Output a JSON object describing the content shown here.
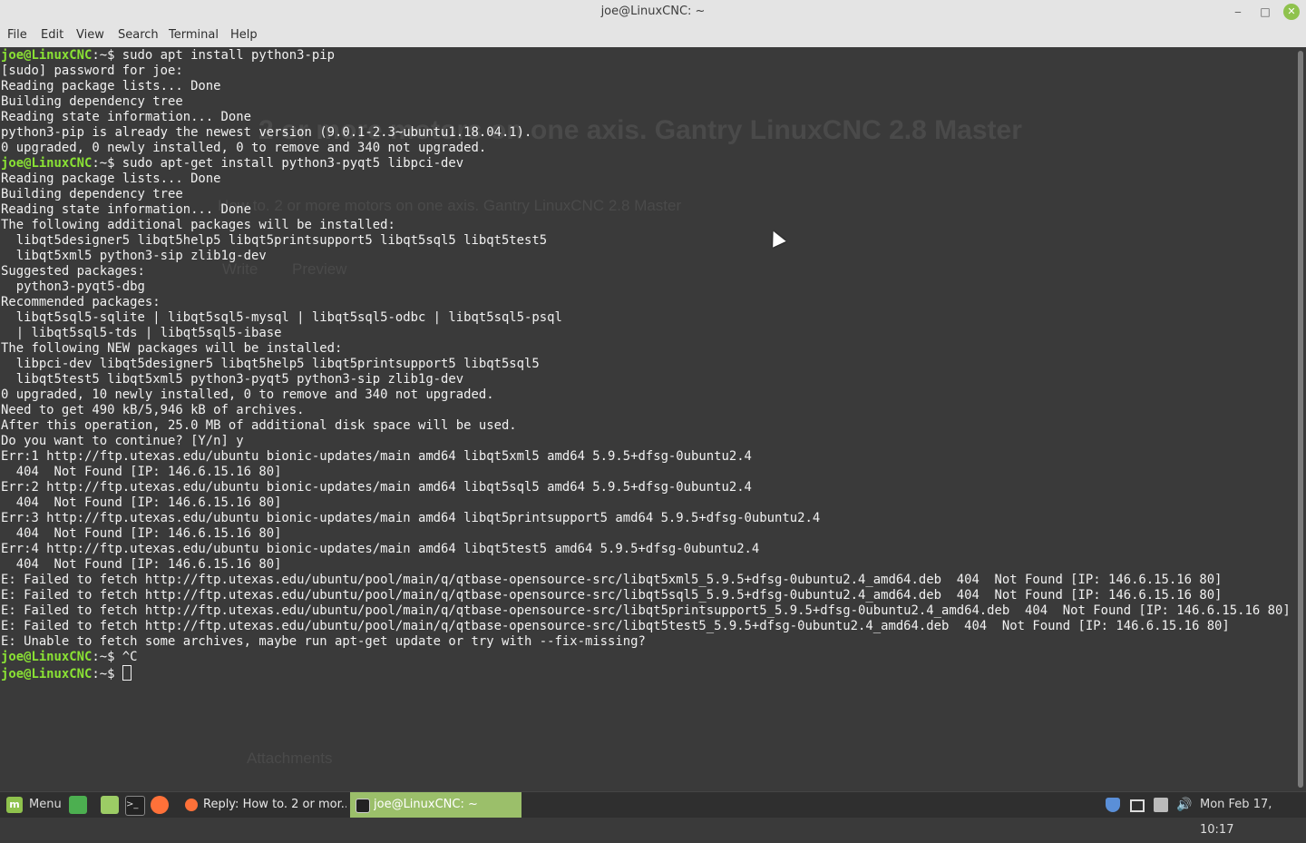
{
  "window": {
    "title": "joe@LinuxCNC: ~",
    "minimize_glyph": "‒",
    "maximize_glyph": "□",
    "close_glyph": "✕"
  },
  "menubar": [
    "File",
    "Edit",
    "View",
    "Search",
    "Terminal",
    "Help"
  ],
  "background_ghost": {
    "heading": "2 or more motors on one axis. Gantry LinuxCNC 2.8 Master",
    "subject": "How to. 2 or more motors on one axis. Gantry LinuxCNC 2.8 Master",
    "tab_write": "Write",
    "tab_preview": "Preview",
    "attachments": "Attachments"
  },
  "terminal": {
    "prompt": "joe@LinuxCNC",
    "lines": [
      {
        "prompt": true,
        "text": ":~$ sudo apt install python3-pip"
      },
      {
        "text": "[sudo] password for joe:"
      },
      {
        "text": "Reading package lists... Done"
      },
      {
        "text": "Building dependency tree"
      },
      {
        "text": "Reading state information... Done"
      },
      {
        "text": "python3-pip is already the newest version (9.0.1-2.3~ubuntu1.18.04.1)."
      },
      {
        "text": "0 upgraded, 0 newly installed, 0 to remove and 340 not upgraded."
      },
      {
        "prompt": true,
        "text": ":~$ sudo apt-get install python3-pyqt5 libpci-dev"
      },
      {
        "text": "Reading package lists... Done"
      },
      {
        "text": "Building dependency tree"
      },
      {
        "text": "Reading state information... Done"
      },
      {
        "text": "The following additional packages will be installed:"
      },
      {
        "text": "  libqt5designer5 libqt5help5 libqt5printsupport5 libqt5sql5 libqt5test5"
      },
      {
        "text": "  libqt5xml5 python3-sip zlib1g-dev"
      },
      {
        "text": "Suggested packages:"
      },
      {
        "text": "  python3-pyqt5-dbg"
      },
      {
        "text": "Recommended packages:"
      },
      {
        "text": "  libqt5sql5-sqlite | libqt5sql5-mysql | libqt5sql5-odbc | libqt5sql5-psql"
      },
      {
        "text": "  | libqt5sql5-tds | libqt5sql5-ibase"
      },
      {
        "text": "The following NEW packages will be installed:"
      },
      {
        "text": "  libpci-dev libqt5designer5 libqt5help5 libqt5printsupport5 libqt5sql5"
      },
      {
        "text": "  libqt5test5 libqt5xml5 python3-pyqt5 python3-sip zlib1g-dev"
      },
      {
        "text": "0 upgraded, 10 newly installed, 0 to remove and 340 not upgraded."
      },
      {
        "text": "Need to get 490 kB/5,946 kB of archives."
      },
      {
        "text": "After this operation, 25.0 MB of additional disk space will be used."
      },
      {
        "text": "Do you want to continue? [Y/n] y"
      },
      {
        "text": "Err:1 http://ftp.utexas.edu/ubuntu bionic-updates/main amd64 libqt5xml5 amd64 5.9.5+dfsg-0ubuntu2.4"
      },
      {
        "text": "  404  Not Found [IP: 146.6.15.16 80]"
      },
      {
        "text": "Err:2 http://ftp.utexas.edu/ubuntu bionic-updates/main amd64 libqt5sql5 amd64 5.9.5+dfsg-0ubuntu2.4"
      },
      {
        "text": "  404  Not Found [IP: 146.6.15.16 80]"
      },
      {
        "text": "Err:3 http://ftp.utexas.edu/ubuntu bionic-updates/main amd64 libqt5printsupport5 amd64 5.9.5+dfsg-0ubuntu2.4"
      },
      {
        "text": "  404  Not Found [IP: 146.6.15.16 80]"
      },
      {
        "text": "Err:4 http://ftp.utexas.edu/ubuntu bionic-updates/main amd64 libqt5test5 amd64 5.9.5+dfsg-0ubuntu2.4"
      },
      {
        "text": "  404  Not Found [IP: 146.6.15.16 80]"
      },
      {
        "text": "E: Failed to fetch http://ftp.utexas.edu/ubuntu/pool/main/q/qtbase-opensource-src/libqt5xml5_5.9.5+dfsg-0ubuntu2.4_amd64.deb  404  Not Found [IP: 146.6.15.16 80]"
      },
      {
        "text": "E: Failed to fetch http://ftp.utexas.edu/ubuntu/pool/main/q/qtbase-opensource-src/libqt5sql5_5.9.5+dfsg-0ubuntu2.4_amd64.deb  404  Not Found [IP: 146.6.15.16 80]"
      },
      {
        "text": "E: Failed to fetch http://ftp.utexas.edu/ubuntu/pool/main/q/qtbase-opensource-src/libqt5printsupport5_5.9.5+dfsg-0ubuntu2.4_amd64.deb  404  Not Found [IP: 146.6.15.16 80]"
      },
      {
        "text": "E: Failed to fetch http://ftp.utexas.edu/ubuntu/pool/main/q/qtbase-opensource-src/libqt5test5_5.9.5+dfsg-0ubuntu2.4_amd64.deb  404  Not Found [IP: 146.6.15.16 80]"
      },
      {
        "text": "E: Unable to fetch some archives, maybe run apt-get update or try with --fix-missing?"
      },
      {
        "prompt": true,
        "text": ":~$ ^C"
      },
      {
        "prompt": true,
        "text": ":~$ ",
        "cursor": true
      }
    ]
  },
  "taskbar": {
    "menu_label": "Menu",
    "quick_launch": [
      "show-desktop-icon",
      "files-icon",
      "terminal-icon",
      "firefox-icon"
    ],
    "windows": [
      {
        "label": "Reply: How to. 2 or mor...",
        "icon": "firefox-icon",
        "active": false
      },
      {
        "label": "joe@LinuxCNC: ~",
        "icon": "terminal-icon",
        "active": true
      }
    ],
    "tray_icons": [
      "shield-icon",
      "notifications-icon",
      "network-icon",
      "volume-icon"
    ],
    "clock": "Mon Feb 17, 10:17"
  },
  "colors": {
    "terminal_bg": "#3a3a3a",
    "terminal_fg": "#f1f1f1",
    "prompt": "#8ae234",
    "accent_mint": "#8fc24d",
    "taskbar_active": "#9bbf6a"
  }
}
